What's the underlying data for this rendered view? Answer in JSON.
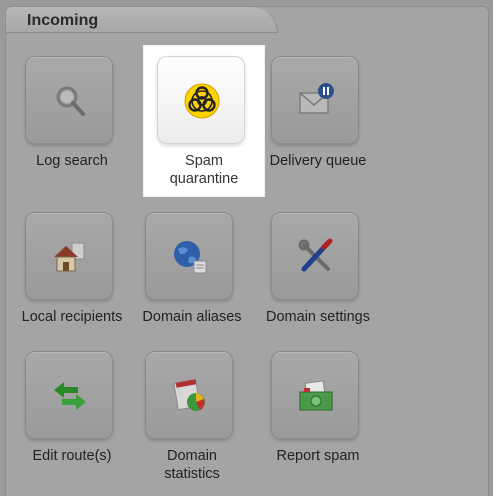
{
  "section": {
    "title": "Incoming"
  },
  "tiles": [
    {
      "label": "Log search",
      "icon": "magnifier-icon"
    },
    {
      "label": "Spam quarantine",
      "icon": "biohazard-icon"
    },
    {
      "label": "Delivery queue",
      "icon": "mail-pause-icon"
    },
    {
      "label": "Local recipients",
      "icon": "home-icon"
    },
    {
      "label": "Domain aliases",
      "icon": "globe-icon"
    },
    {
      "label": "Domain settings",
      "icon": "tools-icon"
    },
    {
      "label": "Edit route(s)",
      "icon": "arrows-icon"
    },
    {
      "label": "Domain statistics",
      "icon": "statistics-icon"
    },
    {
      "label": "Report spam",
      "icon": "cash-report-icon"
    }
  ],
  "colors": {
    "background": "#9a9a9a",
    "highlight": "#ffffff",
    "accent": "#ffd200"
  }
}
